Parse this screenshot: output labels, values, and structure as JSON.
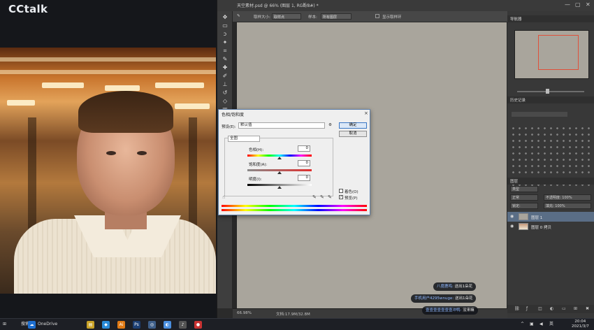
{
  "cctalk": {
    "logo": "CCtalk"
  },
  "photoshop": {
    "doc_tab": "天空素材.psd @ 66% (图层 1, RGB/8#) *",
    "tab_close": "×",
    "window_controls": [
      "—",
      "▢",
      "✕"
    ],
    "options_bar": {
      "sample_size_label": "取样大小:",
      "sample_size_value": "取样点",
      "sample_label": "样本:",
      "sample_value": "所有图层",
      "show_ring_label": "显示取样环"
    },
    "status": {
      "zoom": "66.98%",
      "doc_size": "文档:17.9M/32.8M"
    },
    "panels": {
      "navigator_tab": "导航器",
      "history_tab": "历史记录",
      "layers_tab": "图层",
      "blend_mode": "正常",
      "opacity": "不透明度: 100%",
      "lock_label": "锁定:",
      "fill": "填充: 100%",
      "kind_filter": "类型",
      "layers": [
        {
          "name": "图层 1",
          "selected": true
        },
        {
          "name": "图层 0 拷贝",
          "selected": false
        }
      ]
    }
  },
  "dialog": {
    "title": "色相/饱和度",
    "close": "×",
    "preset_label": "预设(E):",
    "preset_value": "默认值",
    "channel_value": "全图",
    "ok": "确定",
    "cancel": "取消",
    "hue_label": "色相(H):",
    "hue_value": "0",
    "saturation_label": "饱和度(A):",
    "saturation_value": "0",
    "lightness_label": "明度(I):",
    "lightness_value": "0",
    "colorize_label": "着色(O)",
    "preview_label": "预览(P)",
    "preview_checked": true,
    "colorize_checked": false
  },
  "danmaku": [
    {
      "nick": "八度鹿鸣:",
      "text": "送出1朵花"
    },
    {
      "nick": "手机用户4295wnuge:",
      "text": "送出1朵花"
    },
    {
      "nick": "壹壹壹壹壹壹壹冲鸭:",
      "text": "没来嘛"
    }
  ],
  "taskbar": {
    "search": "搜索",
    "onedrive": "OneDrive",
    "time": "20:04",
    "date": "2021/3/7",
    "ime": "英"
  },
  "colors": {
    "accent": "#3b77c4",
    "layer_selected": "#5a6e86",
    "nav_box": "#e0503a"
  }
}
